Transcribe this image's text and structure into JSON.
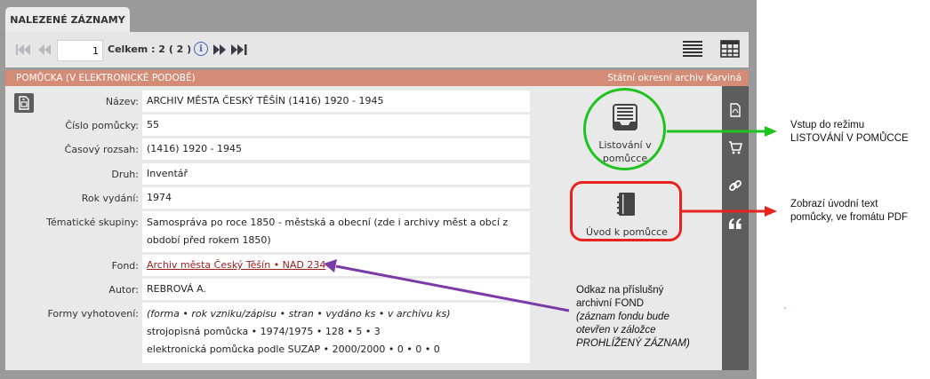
{
  "tab": {
    "label": "NALEZENÉ ZÁZNAMY"
  },
  "pager": {
    "current_page": "1",
    "total_label": "Celkem : 2",
    "total_count": "( 2 )",
    "info_icon": "i"
  },
  "section": {
    "title": "POMŮCKA (V ELEKTRONICKÉ PODOBĚ)",
    "archive": "Státní okresní archiv Karviná"
  },
  "fields": [
    {
      "label": "Název:",
      "value": "ARCHIV MĚSTA ČESKÝ TĚŠÍN (1416) 1920 - 1945"
    },
    {
      "label": "Číslo pomůcky:",
      "value": "55"
    },
    {
      "label": "Časový rozsah:",
      "value": "(1416) 1920 - 1945"
    },
    {
      "label": "Druh:",
      "value": "Inventář"
    },
    {
      "label": "Rok vydání:",
      "value": "1974"
    },
    {
      "label": "Tématické skupiny:",
      "value": "Samospráva po roce 1850 - městská a obecní (zde i archivy měst a obcí z období před rokem 1850)"
    },
    {
      "label": "Fond:",
      "value": "Archiv města Český Těšín • NAD 234"
    },
    {
      "label": "Autor:",
      "value": "REBROVÁ A."
    },
    {
      "label": "Formy vyhotovení:",
      "lines": [
        "(forma • rok vzniku/zápisu • stran • vydáno ks • v archivu ks)",
        "strojopisná pomůcka • 1974/1975 • 128 • 5 • 3",
        "elektronická pomůcka podle SUZAP • 2000/2000 • 0 • 0 • 0"
      ]
    }
  ],
  "actions": {
    "browse_line1": "Listování v",
    "browse_line2": "pomůcce",
    "intro": "Úvod k pomůcce"
  },
  "side_icons": [
    "pdf-icon",
    "cart-icon",
    "link-icon",
    "quote-icon"
  ],
  "annotations": {
    "browse_line1": "Vstup do režimu",
    "browse_line2": "LISTOVÁNÍ V POMŮCCE",
    "intro_line1": "Zobrazí úvodní text",
    "intro_line2": "pomůcky, ve fromátu PDF",
    "fond_line1": "Odkaz na příslušný",
    "fond_line2": "archivní FOND",
    "fond_line3": "(záznam fondu bude",
    "fond_line4": "otevřen v záložce",
    "fond_line5": "PROHLÍŽENÝ ZÁZNAM)"
  },
  "colors": {
    "section_header": "#d48c76",
    "link": "#9b1c1c",
    "green_ring": "#1ec41e",
    "red_ring": "#e8231e",
    "purple_arrow": "#7b3aa8"
  }
}
